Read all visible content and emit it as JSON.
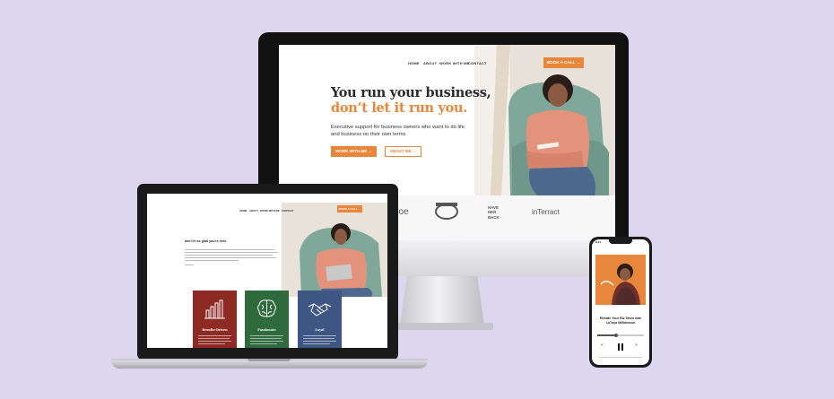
{
  "imac": {
    "nav": [
      "HOME",
      "ABOUT",
      "WORK WITH ME",
      "CONTACT"
    ],
    "cta": "BOOK A CALL →",
    "headline_1": "You run your business,",
    "headline_2": "don’t let it run you.",
    "subtext": "Executive support for business owners who want to do life and business on their own terms",
    "btn_primary": "WORK WITH ME →",
    "btn_secondary": "ABOUT ME →",
    "logos": [
      "boe",
      "HAVE HER BACK",
      "inTerract"
    ]
  },
  "laptop": {
    "nav": [
      "HOME",
      "ABOUT",
      "WORK WITH ME",
      "CONTACT"
    ],
    "cta": "BOOK A CALL →",
    "greeting": "and I'm so glad you're here.",
    "cards": [
      {
        "title": "Results-Driven",
        "color": "#8e2a24"
      },
      {
        "title": "Passionate",
        "color": "#2e6a3c"
      },
      {
        "title": "Loyal",
        "color": "#3e5683"
      }
    ]
  },
  "phone": {
    "time": "9:41",
    "episode_title": "Elevate Your Biz Show with LaToya Williamson",
    "art_colors": {
      "bg": "#e8873b",
      "photo": "#c9866e"
    }
  },
  "colors": {
    "accent": "#e8873b",
    "background": "#ddd6ef"
  }
}
